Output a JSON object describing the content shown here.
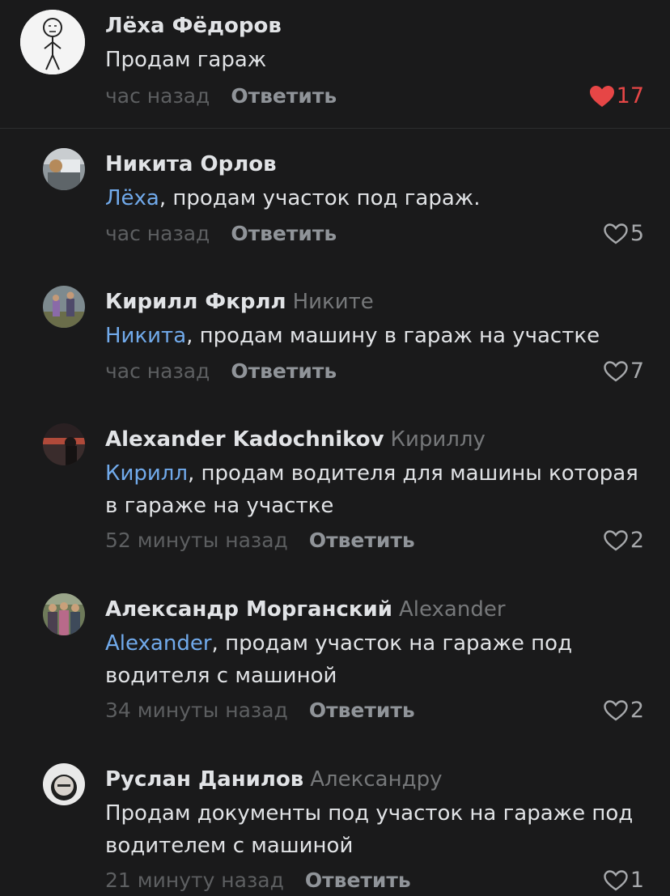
{
  "comments": [
    {
      "author": "Лёха Фёдоров",
      "reply_to": "",
      "mention": "",
      "text": "Продам гараж",
      "time": "час назад",
      "reply_label": "Ответить",
      "likes": "17",
      "liked": true
    },
    {
      "author": "Никита Орлов",
      "reply_to": "",
      "mention": "Лёха",
      "text": ", продам участок под гараж.",
      "time": "час назад",
      "reply_label": "Ответить",
      "likes": "5",
      "liked": false
    },
    {
      "author": "Кирилл Фкрлл",
      "reply_to": "Никите",
      "mention": "Никита",
      "text": ", продам машину в гараж на участке",
      "time": "час назад",
      "reply_label": "Ответить",
      "likes": "7",
      "liked": false
    },
    {
      "author": "Alexander Kadochnikov",
      "reply_to": "Кириллу",
      "mention": "Кирилл",
      "text": ", продам водителя для машины которая в гараже на участке",
      "time": "52 минуты назад",
      "reply_label": "Ответить",
      "likes": "2",
      "liked": false
    },
    {
      "author": "Александр Морганский",
      "reply_to": "Alexander",
      "mention": "Alexander",
      "text": ", продам участок на гараже под водителя с машиной",
      "time": "34 минуты назад",
      "reply_label": "Ответить",
      "likes": "2",
      "liked": false
    },
    {
      "author": "Руслан Данилов",
      "reply_to": "Александру",
      "mention": "",
      "text": "Продам документы под участок  на гараже под водителем с машиной",
      "time": "21 минуту назад",
      "reply_label": "Ответить",
      "likes": "1",
      "liked": false
    }
  ],
  "colors": {
    "background": "#1a1a1b",
    "mention": "#71aaeb",
    "liked_heart": "#e64646",
    "muted": "#76787a"
  },
  "icons": {
    "like_filled": "heart-filled-icon",
    "like_outline": "heart-outline-icon"
  }
}
